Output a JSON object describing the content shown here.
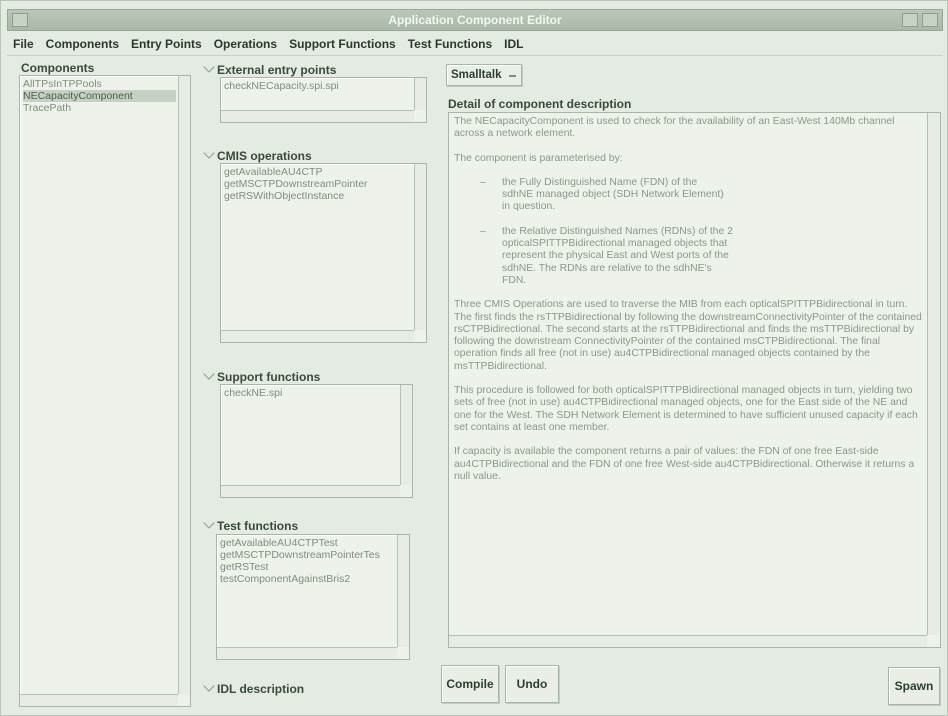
{
  "window": {
    "title": "Application Component Editor"
  },
  "menu": [
    {
      "label": "File"
    },
    {
      "label": "Components"
    },
    {
      "label": "Entry Points"
    },
    {
      "label": "Operations"
    },
    {
      "label": "Support Functions"
    },
    {
      "label": "Test Functions"
    },
    {
      "label": "IDL"
    }
  ],
  "components": {
    "label": "Components",
    "items": [
      "AllTPsInTPPools",
      "NECapacityComponent",
      "TracePath"
    ],
    "selected": "NECapacityComponent"
  },
  "entry_points": {
    "label": "External entry points",
    "items": [
      "checkNECapacity.spi.spi"
    ]
  },
  "cmis_operations": {
    "label": "CMIS operations",
    "items": [
      "getAvailableAU4CTP",
      "getMSCTPDownstreamPointer",
      "getRSWithObjectInstance"
    ]
  },
  "support_functions": {
    "label": "Support functions",
    "items": [
      "checkNE.spi"
    ]
  },
  "test_functions": {
    "label": "Test functions",
    "items": [
      "getAvailableAU4CTPTest",
      "getMSCTPDownstreamPointerTes",
      "getRSTest",
      "testComponentAgainstBris2"
    ]
  },
  "idl_description": {
    "label": "IDL description"
  },
  "language_button": {
    "label": "Smalltalk"
  },
  "description": {
    "label": "Detail of component description",
    "intro": "The NECapacityComponent is used to check for the availability of an East-West 140Mb channel across a network element.",
    "param_intro": "The component is parameterised by:",
    "bullet1": "the Fully Distinguished Name (FDN) of the sdhNE managed object (SDH Network Element) in question.",
    "bullet2": "the Relative Distinguished Names (RDNs) of the 2 opticalSPITTPBidirectional managed objects that represent the physical East and West ports of the sdhNE. The RDNs are relative to the sdhNE's FDN.",
    "para_ops": "Three CMIS Operations are used to traverse the MIB from each opticalSPITTPBidirectional in turn. The first finds the rsTTPBidirectional by following the downstreamConnectivityPointer of the contained rsCTPBidirectional. The second starts at the rsTTPBidirectional and finds the msTTPBidirectional by following the downstream ConnectivityPointer of the contained msCTPBidirectional. The final operation finds all free (not in use) au4CTPBidirectional managed objects contained by the msTTPBidirectional.",
    "para_proc": "This procedure is followed for both opticalSPITTPBidirectional managed objects in turn, yielding two sets of free (not in use) au4CTPBidirectional managed objects, one for the East side of the NE and one for the West. The SDH Network Element is determined to have sufficient unused capacity if each set contains at least one member.",
    "para_result": "If capacity is available the component returns a pair of values: the FDN of one free East-side au4CTPBidirectional and the FDN of one free West-side au4CTPBidirectional. Otherwise it returns a null value."
  },
  "buttons": {
    "compile": "Compile",
    "undo": "Undo",
    "spawn": "Spawn"
  }
}
